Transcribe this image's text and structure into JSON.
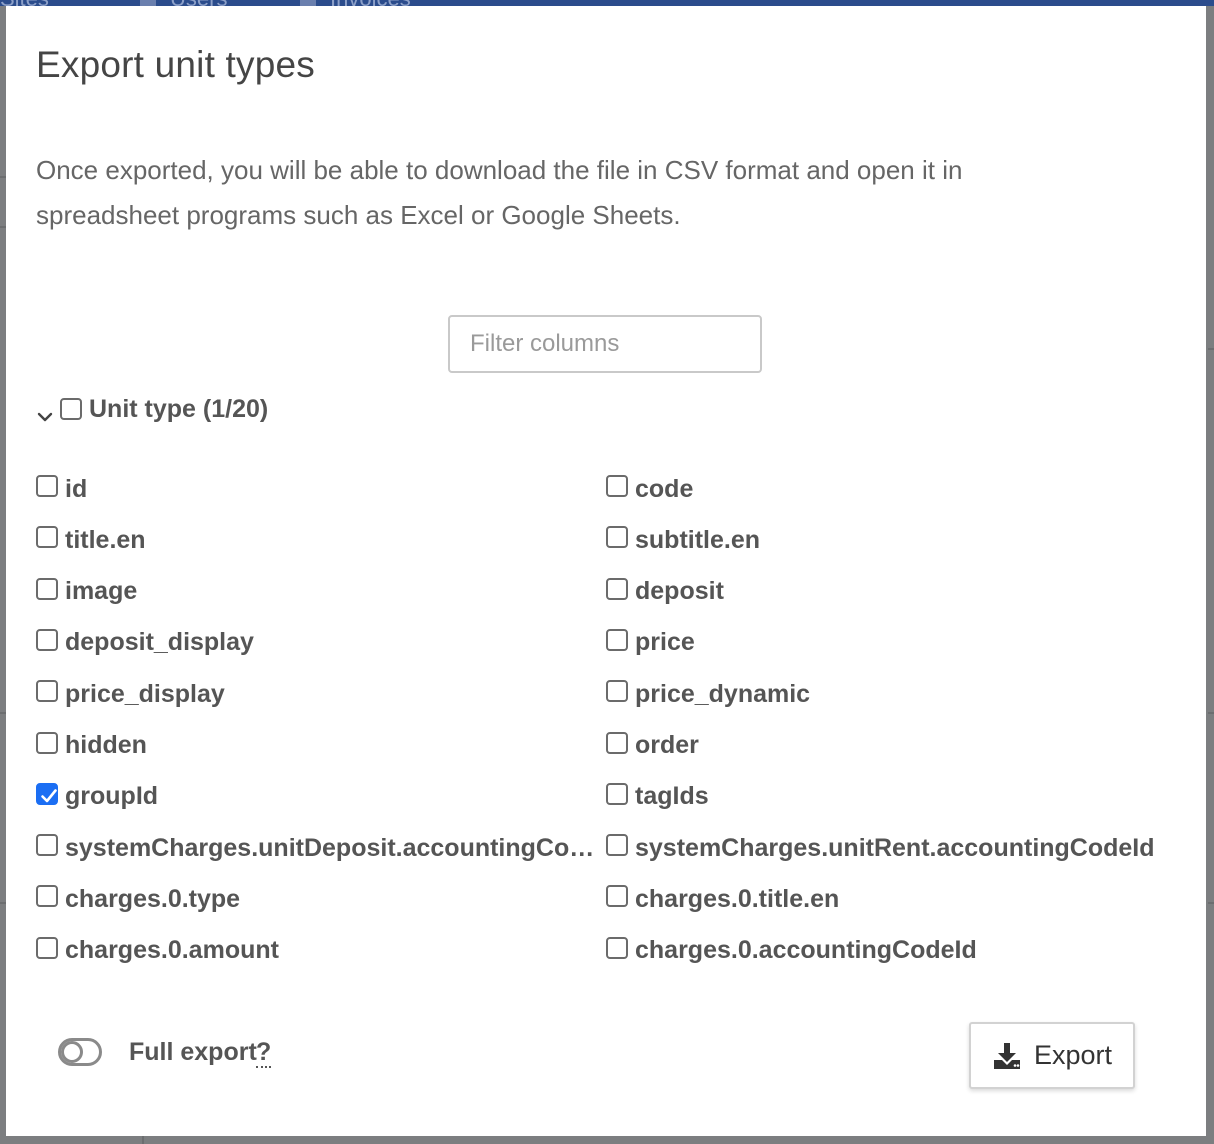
{
  "background_tabs": [
    "Sites",
    "Users",
    "Invoices"
  ],
  "modal": {
    "title": "Export unit types",
    "description": "Once exported, you will be able to download the file in CSV format and open it in spreadsheet programs such as Excel or Google Sheets.",
    "filter_placeholder": "Filter columns",
    "group": {
      "label": "Unit type (1/20)",
      "checked": false,
      "expanded": true
    },
    "columns": [
      {
        "label": "id",
        "checked": false
      },
      {
        "label": "code",
        "checked": false
      },
      {
        "label": "title.en",
        "checked": false
      },
      {
        "label": "subtitle.en",
        "checked": false
      },
      {
        "label": "image",
        "checked": false
      },
      {
        "label": "deposit",
        "checked": false
      },
      {
        "label": "deposit_display",
        "checked": false
      },
      {
        "label": "price",
        "checked": false
      },
      {
        "label": "price_display",
        "checked": false
      },
      {
        "label": "price_dynamic",
        "checked": false
      },
      {
        "label": "hidden",
        "checked": false
      },
      {
        "label": "order",
        "checked": false
      },
      {
        "label": "groupId",
        "checked": true
      },
      {
        "label": "tagIds",
        "checked": false
      },
      {
        "label": "systemCharges.unitDeposit.accountingCod...",
        "checked": false
      },
      {
        "label": "systemCharges.unitRent.accountingCodeId",
        "checked": false
      },
      {
        "label": "charges.0.type",
        "checked": false
      },
      {
        "label": "charges.0.title.en",
        "checked": false
      },
      {
        "label": "charges.0.amount",
        "checked": false
      },
      {
        "label": "charges.0.accountingCodeId",
        "checked": false
      }
    ],
    "full_export": {
      "label": "Full export",
      "help": "?",
      "enabled": false
    },
    "export_button": {
      "label": "Export",
      "icon": "download-icon"
    }
  },
  "colors": {
    "accent": "#1b6ef3",
    "topbar": "#2b4c8c",
    "overlay": "#7c7e80"
  }
}
